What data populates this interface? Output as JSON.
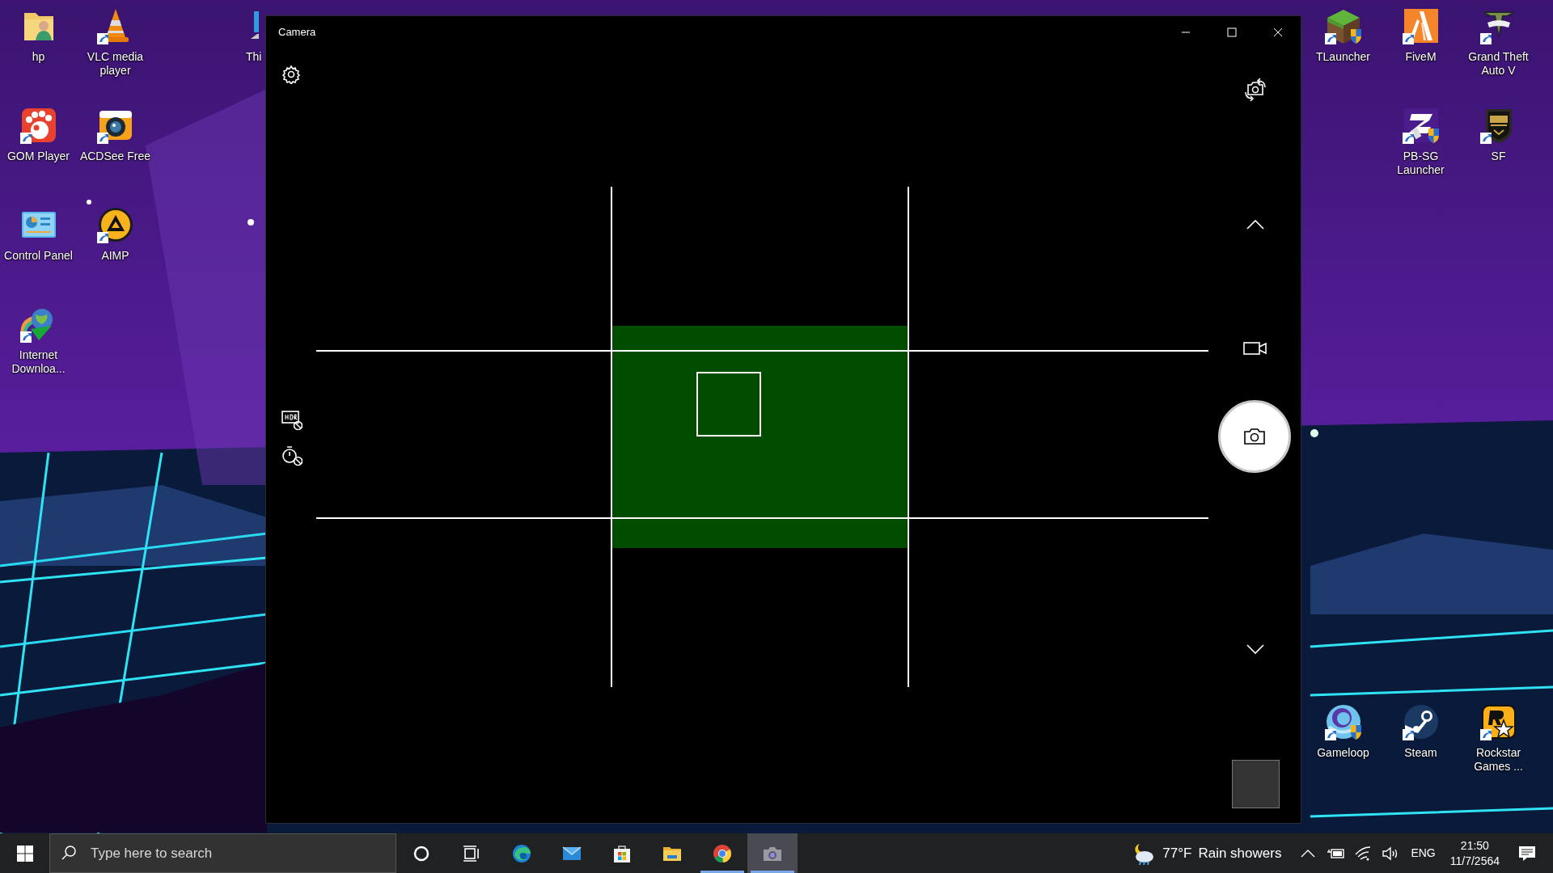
{
  "desktop": {
    "left_icons": [
      {
        "label": "hp",
        "kind": "user-folder",
        "shortcut": false,
        "shield": false
      },
      {
        "label": "VLC media player",
        "kind": "vlc",
        "shortcut": true,
        "shield": false
      },
      {
        "label": "Thi",
        "kind": "this-pc"
      },
      {
        "label": "GOM Player",
        "kind": "gom",
        "shortcut": true,
        "shield": false
      },
      {
        "label": "ACDSee Free",
        "kind": "acdsee",
        "shortcut": true,
        "shield": false
      },
      {
        "label": "Control Panel",
        "kind": "control-panel",
        "shortcut": false,
        "shield": false
      },
      {
        "label": "AIMP",
        "kind": "aimp",
        "shortcut": true,
        "shield": false
      },
      {
        "label": "Internet Downloa...",
        "kind": "idm",
        "shortcut": true,
        "shield": false
      }
    ],
    "right_icons": [
      {
        "label": "TLauncher",
        "kind": "tlauncher",
        "shortcut": true,
        "shield": true
      },
      {
        "label": "FiveM",
        "kind": "fivem",
        "shortcut": true,
        "shield": false
      },
      {
        "label": "Grand Theft Auto V",
        "kind": "gta",
        "shortcut": true,
        "shield": false
      },
      {
        "label": "PB-SG Launcher",
        "kind": "pbsg",
        "shortcut": true,
        "shield": true
      },
      {
        "label": "SF",
        "kind": "sf",
        "shortcut": true,
        "shield": false
      },
      {
        "label": "Gameloop",
        "kind": "gameloop",
        "shortcut": true,
        "shield": true
      },
      {
        "label": "Steam",
        "kind": "steam",
        "shortcut": true,
        "shield": false
      },
      {
        "label": "Rockstar Games ...",
        "kind": "rockstar",
        "shortcut": true,
        "shield": false
      }
    ]
  },
  "camera_window": {
    "title": "Camera",
    "hdr": false,
    "timer": false,
    "grid": true,
    "focus_frame": true
  },
  "taskbar": {
    "search": {
      "placeholder": "Type here to search"
    },
    "apps": [
      {
        "kind": "cortana",
        "running": false,
        "selected": false
      },
      {
        "kind": "task-view",
        "running": false,
        "selected": false
      },
      {
        "kind": "edge",
        "running": false,
        "selected": false
      },
      {
        "kind": "mail",
        "running": false,
        "selected": false
      },
      {
        "kind": "store",
        "running": false,
        "selected": false
      },
      {
        "kind": "explorer",
        "running": false,
        "selected": false
      },
      {
        "kind": "chrome",
        "running": true,
        "selected": false
      },
      {
        "kind": "camera",
        "running": true,
        "selected": true
      }
    ],
    "weather": {
      "temperature": "77°F",
      "condition": "Rain showers"
    },
    "tray": {
      "language": "ENG",
      "time": "21:50",
      "date": "11/7/2564"
    }
  }
}
